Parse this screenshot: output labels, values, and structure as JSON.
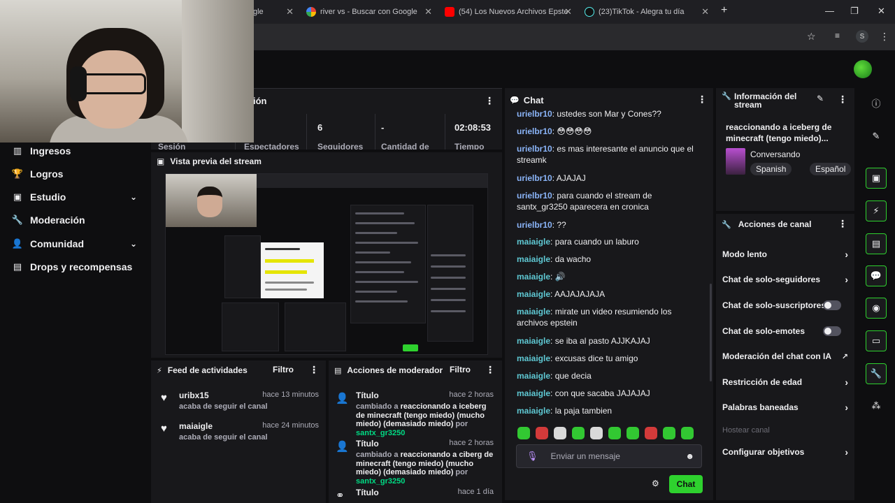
{
  "browser": {
    "tabs": [
      {
        "label": "gle"
      },
      {
        "label": "river vs - Buscar con Google"
      },
      {
        "label": "(54) Los Nuevos Archivos Epste"
      },
      {
        "label": "(23)TikTok - Alegra tu día"
      }
    ],
    "new_tab": "+",
    "minimize": "—",
    "maximize": "❐",
    "close": "✕",
    "profile_initial": "S"
  },
  "nav": {
    "items": [
      {
        "label": "Ingresos",
        "icon": "bar-chart-icon"
      },
      {
        "label": "Logros",
        "icon": "trophy-icon"
      },
      {
        "label": "Estudio",
        "icon": "studio-icon"
      },
      {
        "label": "Moderación",
        "icon": "wrench-icon"
      },
      {
        "label": "Comunidad",
        "icon": "community-icon"
      },
      {
        "label": "Drops y recompensas",
        "icon": "gift-icon"
      }
    ]
  },
  "stats": {
    "title_fragment": "ión",
    "items": [
      {
        "label": "Sesión",
        "value": ""
      },
      {
        "label": "Espectadores",
        "value": ""
      },
      {
        "label": "Seguidores",
        "value": "6"
      },
      {
        "label": "Cantidad de",
        "value": "-"
      },
      {
        "label": "Tiempo",
        "value": "02:08:53"
      }
    ]
  },
  "preview": {
    "title": "Vista previa del stream"
  },
  "feed": {
    "title": "Feed de actividades",
    "filter_label": "Filtro",
    "items": [
      {
        "user": "uribx15",
        "time": "hace 13 minutos",
        "action": "acaba de seguir el canal"
      },
      {
        "user": "maiaigle",
        "time": "hace 24 minutos",
        "action": "acaba de seguir el canal"
      }
    ]
  },
  "mod_actions": {
    "title": "Acciones de moderador",
    "filter_label": "Filtro",
    "items": [
      {
        "title": "Título",
        "time": "hace 2 horas",
        "prefix": "cambiado a",
        "value": "reaccionando a iceberg de minecraft (tengo miedo) (mucho miedo) (demasiado miedo)",
        "by_word": "por",
        "by": "santx_gr3250"
      },
      {
        "title": "Título",
        "time": "hace 2 horas",
        "prefix": "cambiado a",
        "value": "reaccionando a ciberg de minecraft (tengo miedo) (mucho miedo) (demasiado miedo)",
        "by_word": "por",
        "by": "santx_gr3250"
      },
      {
        "title": "Título",
        "time": "hace 1 día",
        "prefix": "",
        "value": "",
        "by_word": "",
        "by": ""
      }
    ]
  },
  "chat": {
    "title": "Chat",
    "messages": [
      {
        "user": "urielbr10",
        "text": "ustedes son Mar y Cones??",
        "color": "blue"
      },
      {
        "user": "urielbr10",
        "text": "😳😳😳😳",
        "color": "blue"
      },
      {
        "user": "urielbr10",
        "text": "es mas interesante el anuncio que el streamk",
        "color": "blue"
      },
      {
        "user": "urielbr10",
        "text": "AJAJAJ",
        "color": "blue"
      },
      {
        "user": "urielbr10",
        "text": "para cuando el stream de santx_gr3250 aparecera en cronica",
        "color": "blue"
      },
      {
        "user": "urielbr10",
        "text": "??",
        "color": "blue"
      },
      {
        "user": "maiaigle",
        "text": "para cuando un laburo",
        "color": "teal"
      },
      {
        "user": "maiaigle",
        "text": "da wacho",
        "color": "teal"
      },
      {
        "user": "maiaigle",
        "text": "🔊",
        "color": "teal"
      },
      {
        "user": "maiaigle",
        "text": "AAJAJAJAJA",
        "color": "teal"
      },
      {
        "user": "maiaigle",
        "text": "mirate un video resumiendo los archivos epstein",
        "color": "teal"
      },
      {
        "user": "maiaigle",
        "text": "se iba al pasto AJJKAJAJ",
        "color": "teal"
      },
      {
        "user": "maiaigle",
        "text": "excusas dice tu amigo",
        "color": "teal"
      },
      {
        "user": "maiaigle",
        "text": "que decia",
        "color": "teal"
      },
      {
        "user": "maiaigle",
        "text": "con que sacaba JAJAJAJ",
        "color": "teal"
      },
      {
        "user": "maiaigle",
        "text": "la paja tambien",
        "color": "teal"
      }
    ],
    "input_placeholder": "Enviar un mensaje",
    "send_label": "Chat"
  },
  "info": {
    "title": "Información del stream",
    "stream_title": "reaccionando a iceberg de minecraft (tengo miedo)...",
    "category": "Conversando",
    "tags": [
      "Spanish",
      "Español"
    ]
  },
  "channel_actions": {
    "title": "Acciones de canal",
    "items": [
      {
        "label": "Modo lento",
        "control": "arrow"
      },
      {
        "label": "Chat de solo-seguidores",
        "control": "arrow"
      },
      {
        "label": "Chat de solo-suscriptores",
        "control": "toggle"
      },
      {
        "label": "Chat de solo-emotes",
        "control": "toggle"
      },
      {
        "label": "Moderación del chat con IA",
        "control": "external"
      },
      {
        "label": "Restricción de edad",
        "control": "arrow"
      },
      {
        "label": "Palabras baneadas",
        "control": "arrow"
      },
      {
        "label": "Hostear canal",
        "control": "none"
      },
      {
        "label": "Configurar objetivos",
        "control": "arrow"
      }
    ]
  },
  "colors": {
    "accent_green": "#2ed12e",
    "bg": "#0e0e10",
    "panel": "#18181b",
    "user_blue": "#8ab4f8",
    "user_teal": "#5fc9d4"
  }
}
